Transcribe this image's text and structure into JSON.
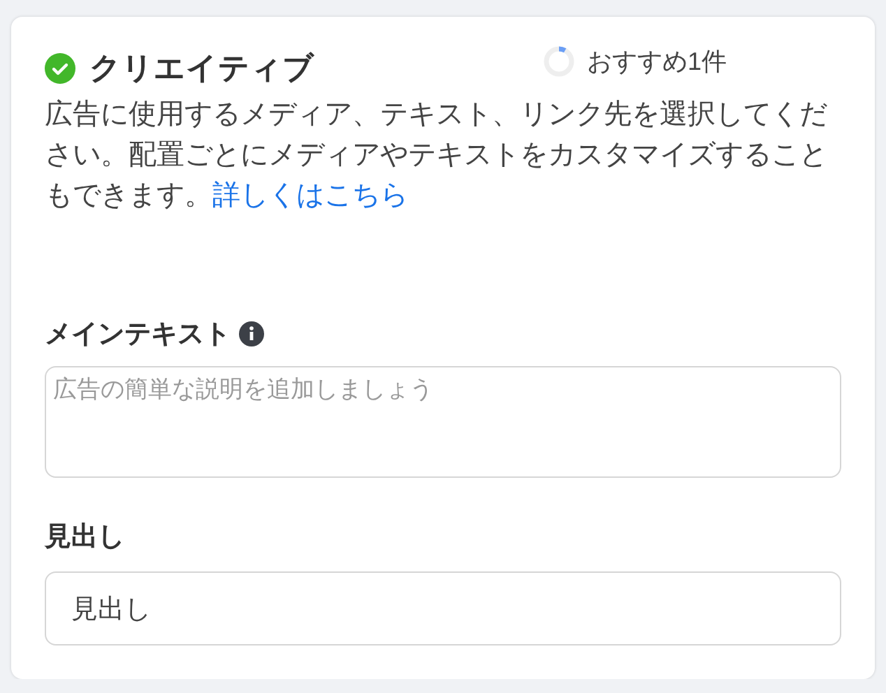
{
  "section": {
    "title": "クリエイティブ",
    "complete": true,
    "recommendation": {
      "label": "おすすめ1件"
    }
  },
  "description": {
    "text": "広告に使用するメディア、テキスト、リンク先を選択してください。配置ごとにメディアやテキストをカスタマイズすることもできます。",
    "link": "詳しくはこちら"
  },
  "fields": [
    {
      "label": "メインテキスト",
      "info": true,
      "kind": "textarea",
      "placeholder": "広告の簡単な説明を追加しましょう"
    },
    {
      "label": "見出し",
      "info": false,
      "kind": "input",
      "value": "見出し"
    }
  ]
}
